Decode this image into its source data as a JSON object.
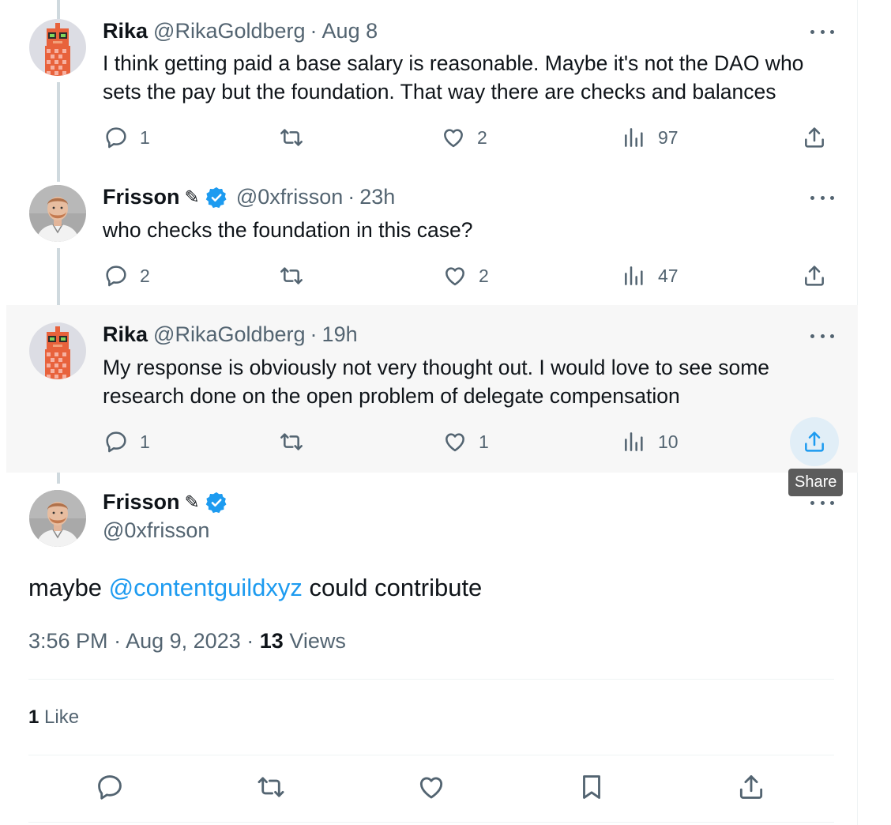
{
  "tweets": [
    {
      "name": "Rika",
      "handle": "@RikaGoldberg",
      "sep": "·",
      "time": "Aug 8",
      "text": "I think getting paid a base salary is reasonable. Maybe it's not the DAO who sets the pay but the foundation. That way there are checks and balances",
      "replies": "1",
      "retweets": "",
      "likes": "2",
      "views": "97"
    },
    {
      "name": "Frisson",
      "pen": "✎",
      "handle": "@0xfrisson",
      "sep": "·",
      "time": "23h",
      "text": "who checks the foundation in this case?",
      "replies": "2",
      "retweets": "",
      "likes": "2",
      "views": "47"
    },
    {
      "name": "Rika",
      "handle": "@RikaGoldberg",
      "sep": "·",
      "time": "19h",
      "text": "My response is obviously not very thought out. I would love to see some research done on the open problem of delegate compensation",
      "replies": "1",
      "retweets": "",
      "likes": "1",
      "views": "10",
      "tooltip": "Share"
    }
  ],
  "main": {
    "name": "Frisson",
    "pen": "✎",
    "handle": "@0xfrisson",
    "text_before": "maybe ",
    "mention": "@contentguildxyz",
    "text_after": " could contribute",
    "time": "3:56 PM",
    "sep": "·",
    "date": "Aug 9, 2023",
    "views_count": "13",
    "views_label": "Views",
    "likes_count": "1",
    "likes_label": "Like"
  },
  "colors": {
    "accent": "#1d9bf0",
    "muted": "#536471",
    "highlight_bg": "#f7f7f7"
  },
  "icons": [
    "reply-icon",
    "retweet-icon",
    "like-icon",
    "views-icon",
    "share-icon",
    "bookmark-icon",
    "more-icon",
    "verified-badge-icon"
  ]
}
